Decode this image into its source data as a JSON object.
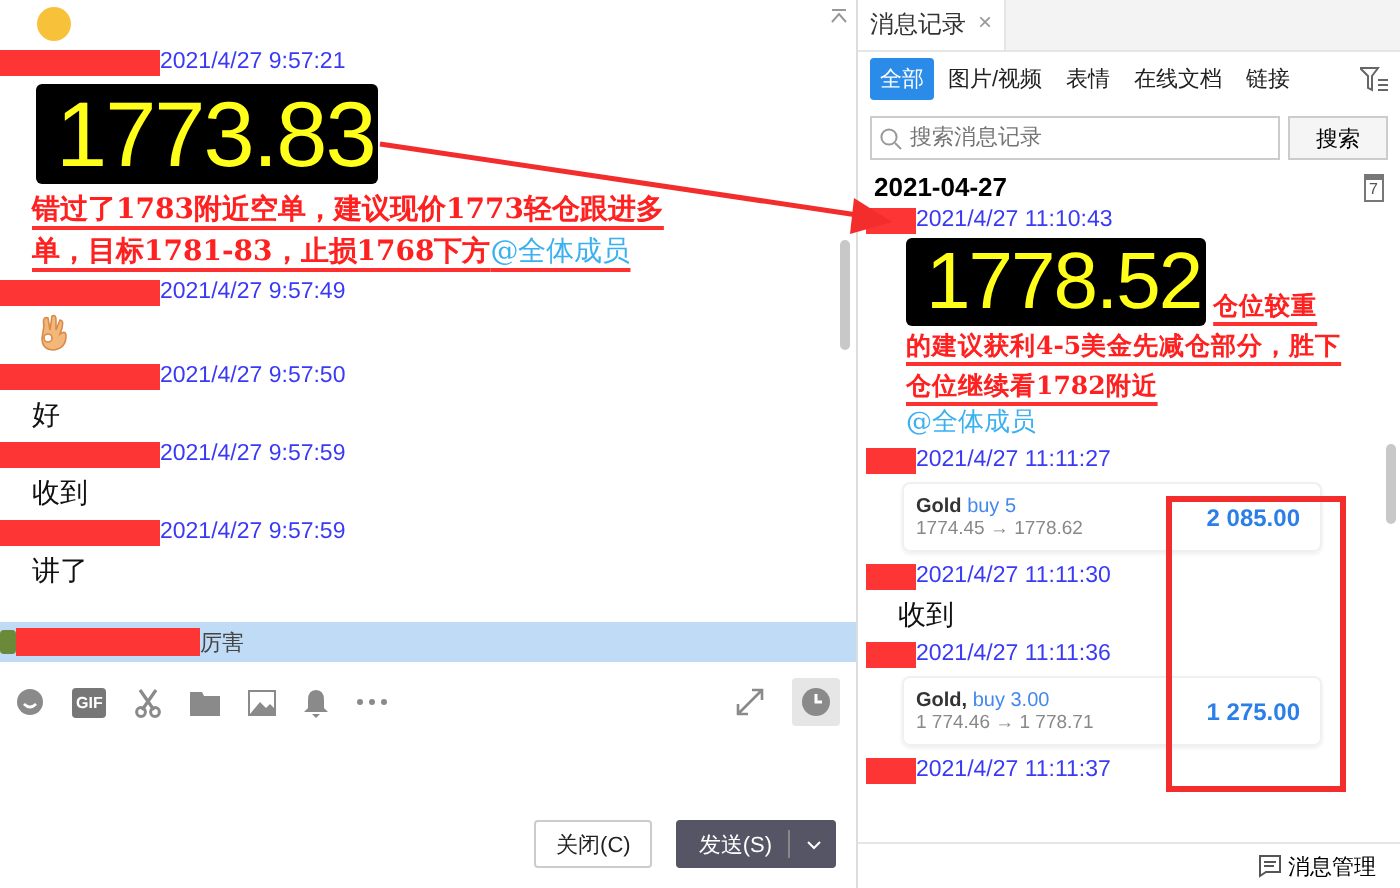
{
  "chat": {
    "messages": [
      {
        "items": [
          {
            "kind": "emoji"
          }
        ]
      },
      {
        "time": "2021/4/27 9:57:21",
        "items": [
          {
            "kind": "price",
            "text": "1773.83"
          },
          {
            "kind": "annotation",
            "text": "错过了1783附近空单，建议现价1773轻仓跟进多单，目标1781-83，止损1768下方",
            "mention": "@全体成员"
          }
        ]
      },
      {
        "time": "2021/4/27 9:57:49",
        "items": [
          {
            "kind": "ok"
          }
        ]
      },
      {
        "time": "2021/4/27 9:57:50",
        "items": [
          {
            "kind": "text",
            "text": "好"
          }
        ]
      },
      {
        "time": "2021/4/27 9:57:59",
        "items": [
          {
            "kind": "text",
            "text": "收到"
          }
        ]
      },
      {
        "time": "2021/4/27 9:57:59",
        "items": [
          {
            "kind": "text",
            "text": "讲了"
          }
        ]
      }
    ],
    "notice": "厉害",
    "toolbar": {
      "gif": "GIF"
    },
    "buttons": [
      {
        "label": "关闭(C)",
        "primary": false
      },
      {
        "label": "发送(S)",
        "primary": true
      }
    ]
  },
  "history": {
    "tab": "消息记录",
    "tab_close": "×",
    "filters": [
      {
        "label": "全部",
        "selected": true
      },
      {
        "label": "图片/视频",
        "selected": false
      },
      {
        "label": "表情",
        "selected": false
      },
      {
        "label": "在线文档",
        "selected": false
      },
      {
        "label": "链接",
        "selected": false
      }
    ],
    "search": {
      "placeholder": "搜索消息记录",
      "button": "搜索"
    },
    "date": "2021-04-27",
    "calendar": "7",
    "messages": [
      {
        "time": "2021/4/27 11:10:43",
        "items": [
          {
            "kind": "price",
            "text": "1778.52",
            "note": "仓位较重"
          },
          {
            "kind": "annotation",
            "text": "的建议获利4-5美金先减仓部分，胜下仓位继续看1782附近"
          },
          {
            "kind": "mention",
            "text": "@全体成员"
          }
        ]
      },
      {
        "time": "2021/4/27 11:11:27",
        "items": [
          {
            "kind": "trade",
            "symbol": "Gold",
            "side": "buy 5",
            "prices": "1774.45 → 1778.62",
            "profit": "2 085.00"
          }
        ]
      },
      {
        "time": "2021/4/27 11:11:30",
        "items": [
          {
            "kind": "text",
            "text": "收到"
          }
        ]
      },
      {
        "time": "2021/4/27 11:11:36",
        "items": [
          {
            "kind": "trade",
            "symbol": "Gold,",
            "side": "buy 3.00",
            "prices": "1 774.46 → 1 778.71",
            "profit": "1 275.00"
          }
        ]
      },
      {
        "time": "2021/4/27 11:11:37"
      }
    ],
    "footer": "消息管理"
  }
}
